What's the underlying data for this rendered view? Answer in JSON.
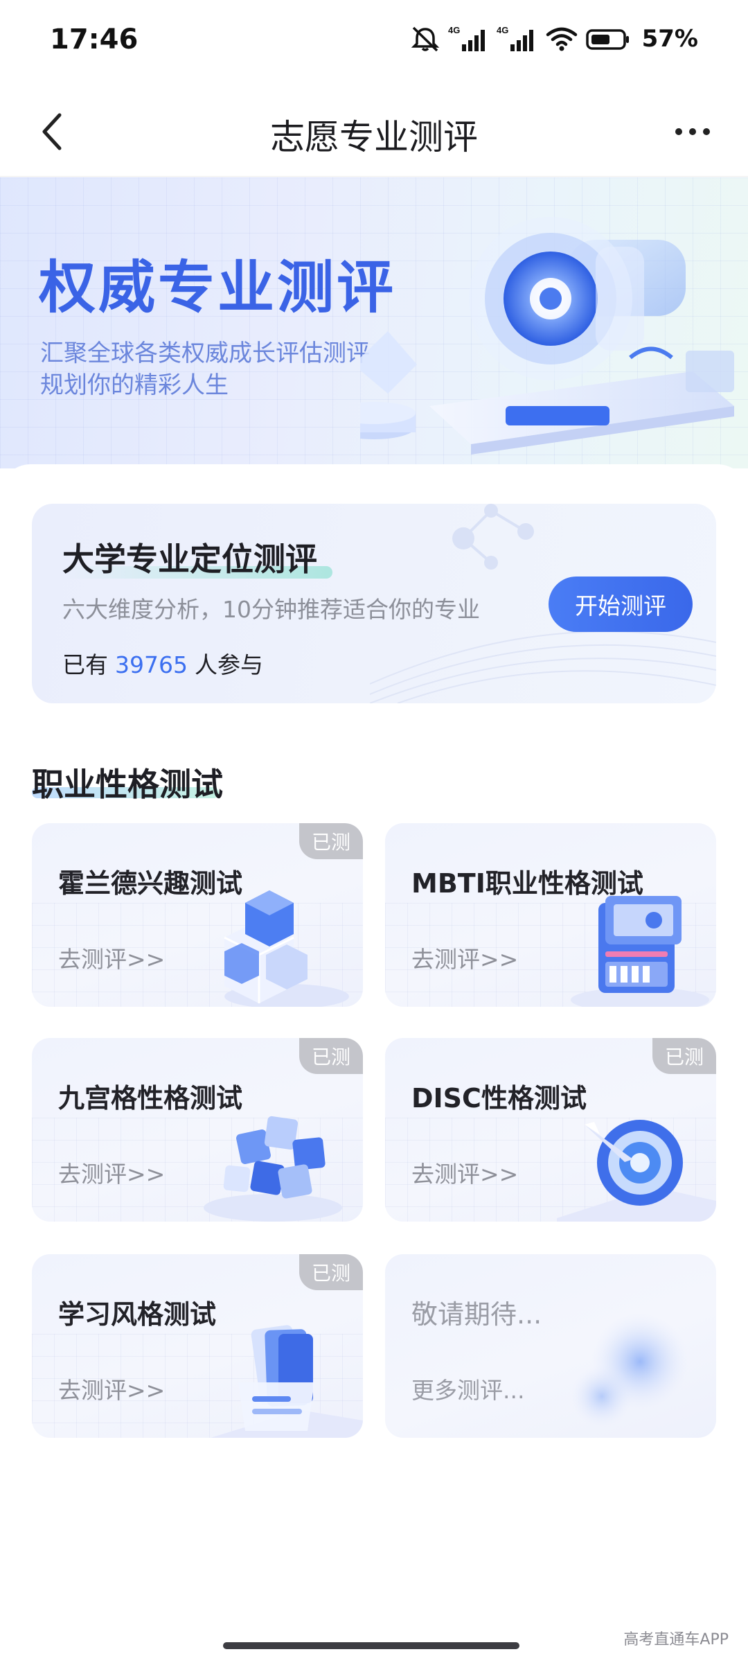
{
  "status": {
    "time": "17:46",
    "network1": "4G",
    "network2": "4G",
    "battery": "57%"
  },
  "nav": {
    "title": "志愿专业测评"
  },
  "banner": {
    "title": "权威专业测评",
    "subtitle_line1": "汇聚全球各类权威成长评估测评",
    "subtitle_line2": "规划你的精彩人生"
  },
  "feature": {
    "title": "大学专业定位测评",
    "description": "六大维度分析，10分钟推荐适合你的专业",
    "count_prefix": "已有",
    "count": "39765",
    "count_suffix": "人参与",
    "button_label": "开始测评"
  },
  "section": {
    "title": "职业性格测试"
  },
  "tests": [
    {
      "title": "霍兰德兴趣测试",
      "link": "去测评>>",
      "badge": "已测"
    },
    {
      "title": "MBTI职业性格测试",
      "link": "去测评>>"
    },
    {
      "title": "九宫格性格测试",
      "link": "去测评>>",
      "badge": "已测"
    },
    {
      "title": "DISC性格测试",
      "link": "去测评>>",
      "badge": "已测"
    },
    {
      "title": "学习风格测试",
      "link": "去测评>>",
      "badge": "已测"
    },
    {
      "title": "敬请期待...",
      "link": "更多测评..."
    }
  ],
  "footer": {
    "watermark": "高考直通车APP"
  },
  "theme": {
    "accent": "#3b6ff0",
    "banner_title": "#3a63e6",
    "badge_bg": "#c4c5cb"
  }
}
